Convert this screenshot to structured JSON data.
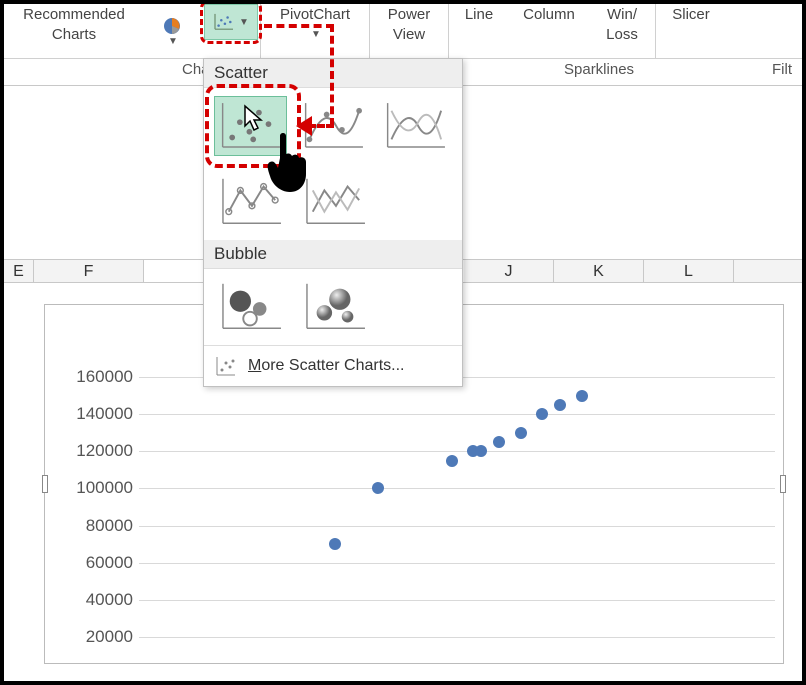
{
  "ribbon": {
    "recommended_line1": "Recommended",
    "recommended_line2": "Charts",
    "pivotchart": "PivotChart",
    "power_line1": "Power",
    "power_line2": "View",
    "line": "Line",
    "column": "Column",
    "winloss_line1": "Win/",
    "winloss_line2": "Loss",
    "slicer": "Slicer"
  },
  "groups": {
    "charts": "Cha",
    "sparklines": "Sparklines",
    "filters": "Filt"
  },
  "dropdown": {
    "scatter_label": "Scatter",
    "bubble_label": "Bubble",
    "more": "More Scatter Charts..."
  },
  "columns": {
    "E": "E",
    "F": "F",
    "J": "J",
    "K": "K",
    "L": "L"
  },
  "chart_data": {
    "type": "scatter",
    "title": "",
    "xlabel": "",
    "ylabel": "",
    "ylim": [
      20000,
      160000
    ],
    "yticks": [
      20000,
      40000,
      60000,
      80000,
      100000,
      120000,
      140000,
      160000
    ],
    "x": [
      3.7,
      4.5,
      5.9,
      6.3,
      6.45,
      6.8,
      7.2,
      7.6,
      7.95,
      8.35
    ],
    "values": [
      70000,
      100000,
      115000,
      120000,
      120000,
      125000,
      130000,
      140000,
      145000,
      150000
    ]
  }
}
